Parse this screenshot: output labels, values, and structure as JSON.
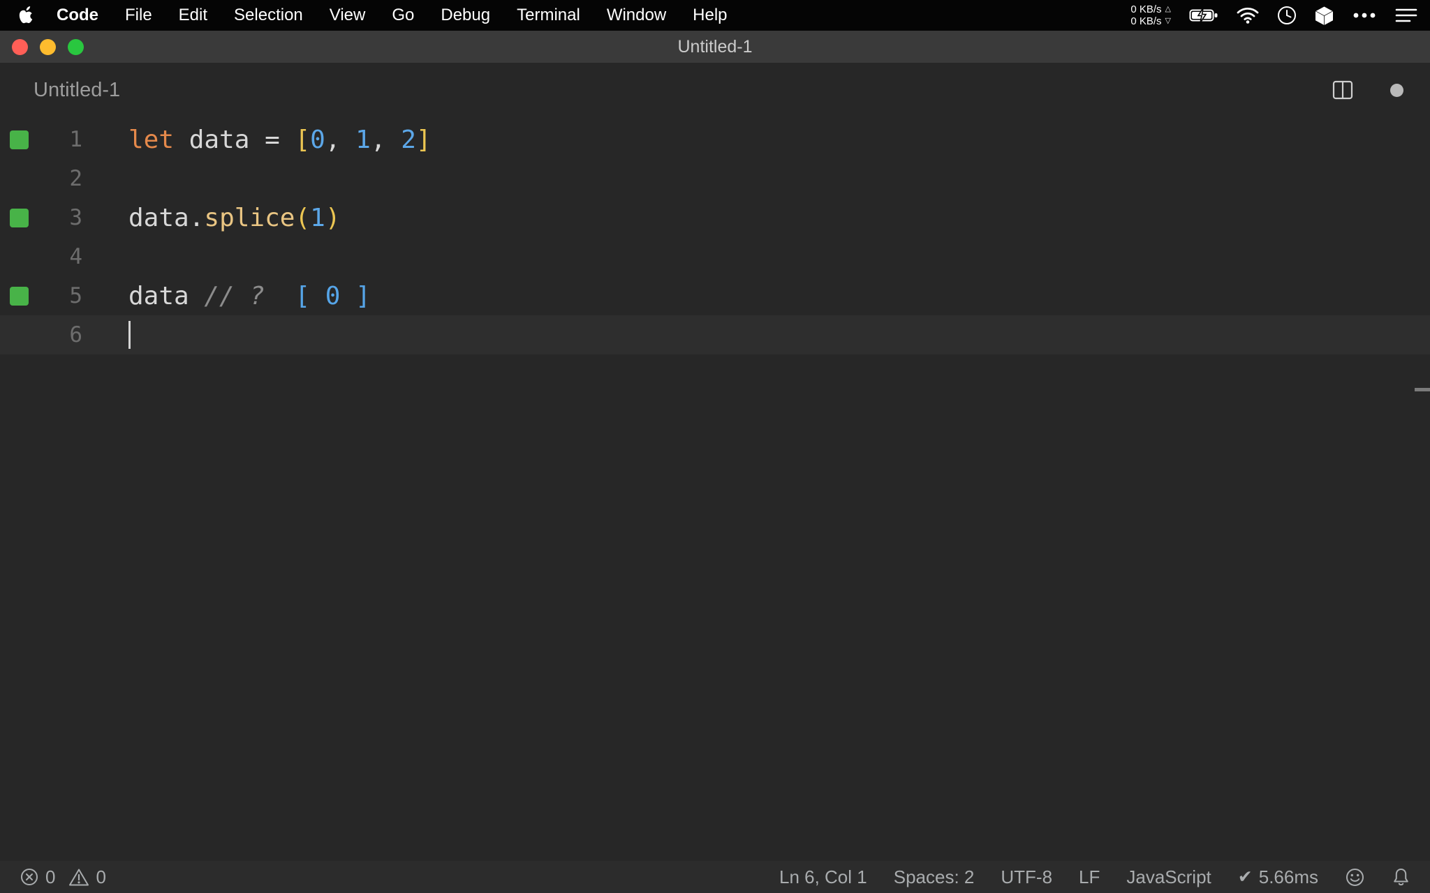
{
  "menubar": {
    "app_name": "Code",
    "items": [
      "File",
      "Edit",
      "Selection",
      "View",
      "Go",
      "Debug",
      "Terminal",
      "Window",
      "Help"
    ],
    "network": {
      "up_label": "0 KB/s",
      "down_label": "0 KB/s",
      "up_arrow": "△",
      "down_arrow": "▽"
    }
  },
  "window": {
    "title": "Untitled-1"
  },
  "editor": {
    "tab_title": "Untitled-1",
    "lines": [
      {
        "num": "1",
        "covered": true,
        "current": false,
        "tokens": [
          {
            "t": "let",
            "c": "keyword"
          },
          {
            "t": " data ",
            "c": "plain"
          },
          {
            "t": "= ",
            "c": "plain"
          },
          {
            "t": "[",
            "c": "bracket"
          },
          {
            "t": "0",
            "c": "number"
          },
          {
            "t": ", ",
            "c": "plain"
          },
          {
            "t": "1",
            "c": "number"
          },
          {
            "t": ", ",
            "c": "plain"
          },
          {
            "t": "2",
            "c": "number"
          },
          {
            "t": "]",
            "c": "bracket"
          }
        ]
      },
      {
        "num": "2",
        "covered": false,
        "current": false,
        "tokens": []
      },
      {
        "num": "3",
        "covered": true,
        "current": false,
        "tokens": [
          {
            "t": "data",
            "c": "plain"
          },
          {
            "t": ".",
            "c": "plain"
          },
          {
            "t": "splice",
            "c": "function"
          },
          {
            "t": "(",
            "c": "bracket"
          },
          {
            "t": "1",
            "c": "number"
          },
          {
            "t": ")",
            "c": "bracket"
          }
        ]
      },
      {
        "num": "4",
        "covered": false,
        "current": false,
        "tokens": []
      },
      {
        "num": "5",
        "covered": true,
        "current": false,
        "tokens": [
          {
            "t": "data ",
            "c": "plain"
          },
          {
            "t": "// ?",
            "c": "comment"
          },
          {
            "t": "  ",
            "c": "plain"
          },
          {
            "t": "[ 0 ]",
            "c": "quokka"
          }
        ]
      },
      {
        "num": "6",
        "covered": false,
        "current": true,
        "tokens": []
      }
    ]
  },
  "statusbar": {
    "errors": "0",
    "warnings": "0",
    "line_col": "Ln 6, Col 1",
    "spaces": "Spaces: 2",
    "encoding": "UTF-8",
    "eol": "LF",
    "language": "JavaScript",
    "check_glyph": "✔",
    "perf_time": "5.66ms"
  },
  "colors": {
    "coverage_green": "#48b348",
    "keyword_orange": "#e5894b",
    "number_blue": "#5ca7e8",
    "bracket_gold": "#ecc652",
    "traffic_red": "#ff5f57",
    "traffic_yellow": "#febc2e",
    "traffic_green": "#29c73f"
  }
}
